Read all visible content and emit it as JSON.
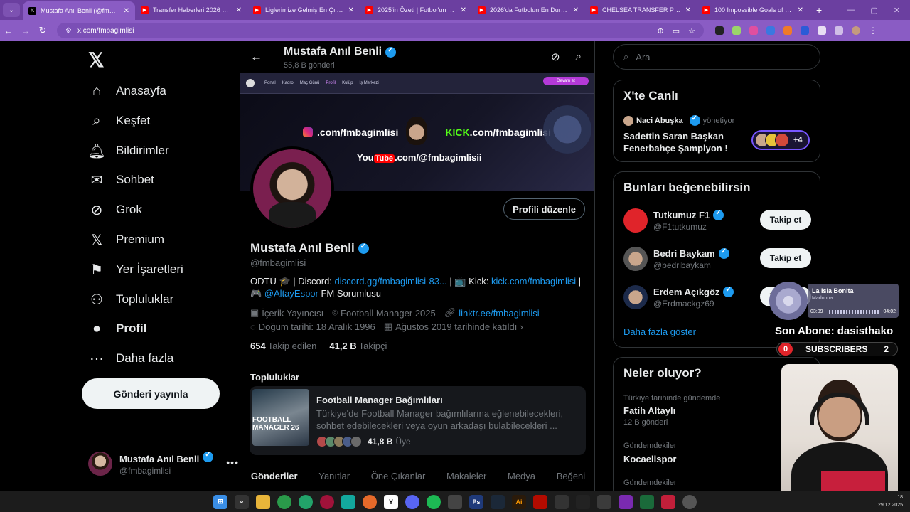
{
  "browser": {
    "tabs": [
      {
        "title": "Mustafa Anıl Benli (@fmbagimlisi) / X",
        "kind": "x",
        "active": true
      },
      {
        "title": "Transfer Haberleri 2026 Başladı",
        "kind": "yt",
        "active": false
      },
      {
        "title": "Liglerimize Gelmiş En Çılgın 10",
        "kind": "yt",
        "active": false
      },
      {
        "title": "2025'in Özeti | Futbol'un akıldan",
        "kind": "yt",
        "active": false
      },
      {
        "title": "2026'da Futbolun En Durdurulamaz",
        "kind": "yt",
        "active": false
      },
      {
        "title": "CHELSEA TRANSFER PROJESİNİ",
        "kind": "yt",
        "active": false
      },
      {
        "title": "100 Impossible Goals of 2025",
        "kind": "yt",
        "active": false
      }
    ],
    "url": "x.com/fmbagimlisi",
    "accent": "#8a5cc4"
  },
  "nav": {
    "items": [
      {
        "label": "Anasayfa",
        "icon": "home-icon"
      },
      {
        "label": "Keşfet",
        "icon": "search-icon"
      },
      {
        "label": "Bildirimler",
        "icon": "bell-icon"
      },
      {
        "label": "Sohbet",
        "icon": "mail-icon"
      },
      {
        "label": "Grok",
        "icon": "grok-icon"
      },
      {
        "label": "Premium",
        "icon": "x-logo-icon"
      },
      {
        "label": "Yer İşaretleri",
        "icon": "bookmark-icon"
      },
      {
        "label": "Topluluklar",
        "icon": "people-icon"
      },
      {
        "label": "Profil",
        "icon": "user-icon"
      },
      {
        "label": "Daha fazla",
        "icon": "more-circle-icon"
      }
    ],
    "post_button": "Gönderi yayınla",
    "account": {
      "name": "Mustafa Anıl Benli",
      "handle": "@fmbagimlisi"
    }
  },
  "profile": {
    "header_name": "Mustafa Anıl Benli",
    "post_count": "55,8 B gönderi",
    "banner": {
      "instagram": ".com/fmbagimlisi",
      "kick_brand": "KICK",
      "kick": ".com/fmbagimlisi",
      "youtube_brand": "You",
      "youtube_tube": "Tube",
      "youtube": ".com/@fmbagimlisii",
      "menu": [
        "Portal",
        "Kadro",
        "Maç Günü",
        "Profil",
        "Kulüp",
        "İş Merkezi"
      ],
      "continue": "Devam et"
    },
    "edit_button": "Profili düzenle",
    "name": "Mustafa Anıl Benli",
    "handle": "@fmbagimlisi",
    "bio": {
      "part1": "ODTÜ 🎓 | Discord: ",
      "discord": "discord.gg/fmbagimlisi-83...",
      "part2": " | 📺 Kick: ",
      "kick": "kick.com/fmbagimlisi",
      "part3": " | 🎮 ",
      "altay": "@AltayEspor",
      "part4": " FM Sorumlusu"
    },
    "meta": {
      "category": "İçerik Yayıncısı",
      "location": "Football Manager 2025",
      "link": "linktr.ee/fmbagimlisi",
      "birth": "Doğum tarihi: 18 Aralık 1996",
      "joined": "Ağustos 2019 tarihinde katıldı"
    },
    "following_count": "654",
    "following_label": "Takip edilen",
    "followers_count": "41,2 B",
    "followers_label": "Takipçi",
    "communities_heading": "Topluluklar",
    "community": {
      "image_text": "FOOTBALL MANAGER 26",
      "title": "Football Manager Bağımlıları",
      "desc": "Türkiye'de Football Manager bağımlılarına eğlenebilecekleri, sohbet edebilecekleri veya oyun arkadaşı bulabilecekleri ...",
      "members": "41,8 B",
      "members_label": "Üye"
    },
    "tabs": [
      "Gönderiler",
      "Yanıtlar",
      "Öne Çıkanlar",
      "Makaleler",
      "Medya",
      "Beğeni"
    ]
  },
  "sidebar": {
    "search_placeholder": "Ara",
    "live": {
      "heading": "X'te Canlı",
      "host": "Naci Abuşka",
      "host_action": "yönetiyor",
      "title": "Sadettin Saran Başkan Fenerbahçe Şampiyon !",
      "extra": "+4"
    },
    "suggest": {
      "heading": "Bunları beğenebilirsin",
      "items": [
        {
          "name": "Tutkumuz F1",
          "handle": "@F1tutkumuz",
          "button": "Takip et"
        },
        {
          "name": "Bedri Baykam",
          "handle": "@bedribaykam",
          "button": "Takip et"
        },
        {
          "name": "Erdem Açıkgöz",
          "handle": "@Erdmackgz69",
          "button": "Takip et"
        }
      ],
      "show_more": "Daha fazla göster"
    },
    "trends": {
      "heading": "Neler oluyor?",
      "items": [
        {
          "context": "Türkiye tarihinde gündemde",
          "title": "Fatih Altaylı",
          "count": "12 B gönderi"
        },
        {
          "context": "Gündemdekiler",
          "title": "Kocaelispor"
        },
        {
          "context": "Gündemdekiler"
        }
      ]
    }
  },
  "overlay": {
    "song": "La Isla Bonita",
    "artist": "Madonna",
    "time_elapsed": "03:09",
    "time_total": "04:02",
    "last_sub": "Son Abone: dasisthako",
    "sub_left": "0",
    "sub_label": "SUBSCRIBERS",
    "sub_right": "2"
  },
  "taskbar": {
    "time": "18",
    "date": "29.12.2025"
  }
}
